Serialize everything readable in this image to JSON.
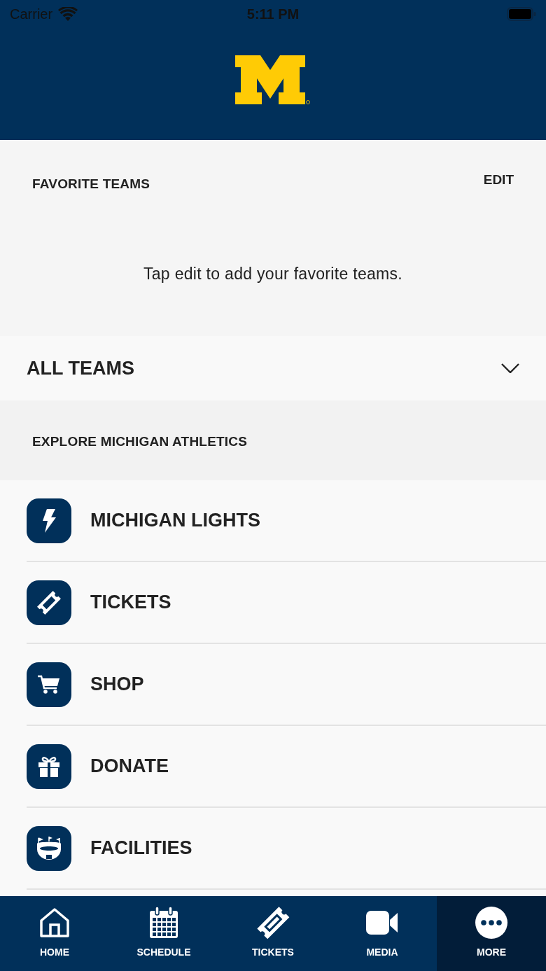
{
  "status_bar": {
    "carrier": "Carrier",
    "time": "5:11 PM"
  },
  "favorite_teams": {
    "title": "FAVORITE TEAMS",
    "edit": "EDIT",
    "empty_message": "Tap edit to add your favorite teams."
  },
  "all_teams": {
    "label": "ALL TEAMS",
    "expanded": false
  },
  "explore": {
    "title": "EXPLORE MICHIGAN ATHLETICS",
    "items": [
      {
        "label": "MICHIGAN LIGHTS"
      },
      {
        "label": "TICKETS"
      },
      {
        "label": "SHOP"
      },
      {
        "label": "DONATE"
      },
      {
        "label": "FACILITIES"
      }
    ]
  },
  "tab_bar": [
    {
      "label": "HOME",
      "selected": false
    },
    {
      "label": "SCHEDULE",
      "selected": false
    },
    {
      "label": "TICKETS",
      "selected": false
    },
    {
      "label": "MEDIA",
      "selected": false
    },
    {
      "label": "MORE",
      "selected": true
    }
  ]
}
